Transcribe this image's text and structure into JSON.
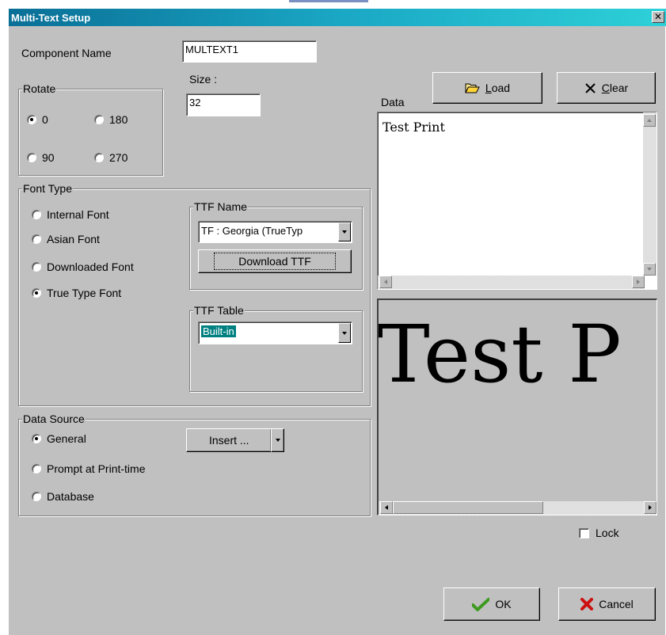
{
  "window": {
    "title": "Multi-Text Setup",
    "close_glyph": "✕"
  },
  "component": {
    "label": "Component Name",
    "value": "MULTEXT1"
  },
  "rotate": {
    "label": "Rotate",
    "options": [
      {
        "label": "0",
        "checked": true
      },
      {
        "label": "180",
        "checked": false
      },
      {
        "label": "90",
        "checked": false
      },
      {
        "label": "270",
        "checked": false
      }
    ]
  },
  "size": {
    "label": "Size :",
    "value": "32"
  },
  "font_type": {
    "label": "Font Type",
    "options": [
      {
        "label": "Internal Font",
        "checked": false
      },
      {
        "label": "Asian Font",
        "checked": false
      },
      {
        "label": "Downloaded Font",
        "checked": false
      },
      {
        "label": "True Type Font",
        "checked": true
      }
    ]
  },
  "ttf_name": {
    "label": "TTF Name",
    "selected": "TF : Georgia (TrueTyp",
    "download_button": "Download TTF"
  },
  "ttf_table": {
    "label": "TTF Table",
    "selected": "Built-in",
    "highlight_color": "#008080"
  },
  "data_source": {
    "label": "Data Source",
    "options": [
      {
        "label": "General",
        "checked": true
      },
      {
        "label": "Prompt at Print-time",
        "checked": false
      },
      {
        "label": "Database",
        "checked": false
      }
    ],
    "insert_button": "Insert ..."
  },
  "toolbar": {
    "load_label": "Load",
    "clear_label": "Clear"
  },
  "data": {
    "label": "Data",
    "text": "Test Print"
  },
  "preview": {
    "text": "Test P"
  },
  "lock": {
    "label": "Lock",
    "checked": false
  },
  "footer": {
    "ok_label": "OK",
    "cancel_label": "Cancel",
    "ok_icon_color": "#3c9a1e",
    "cancel_icon_color": "#cc1111"
  },
  "icons": {
    "load": "folder-open-icon",
    "clear": "x-icon",
    "ok": "checkmark-icon",
    "cancel": "red-x-icon"
  }
}
